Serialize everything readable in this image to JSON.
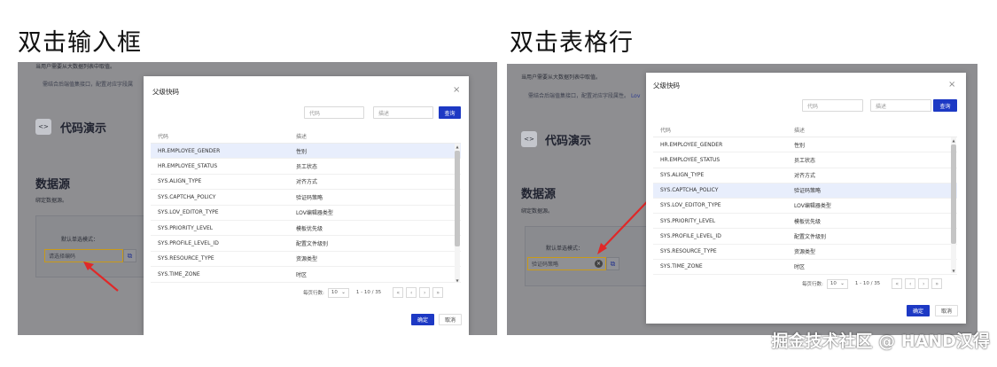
{
  "left_heading": "双击输入框",
  "right_heading": "双击表格行",
  "watermark": "掘金技术社区 @ HAND汉得",
  "bg": {
    "line1": "当用户需要从大数据列表中取值。",
    "line2_left": "需结合后端值集接口，配置对应字段属",
    "line2_right": "需结合后端值集接口，配置对应字段属性。",
    "line2_right_link": "Lov",
    "code_icon": "<>",
    "code_title": "代码演示",
    "datasource": "数据源",
    "bind_datasource": "绑定数据源。",
    "default_mode": "默认单选模式：",
    "left_placeholder": "请选择编码",
    "right_value": "验证码策略"
  },
  "modal": {
    "title": "父级快码",
    "close": "×",
    "code_placeholder": "代码",
    "desc_placeholder": "描述",
    "query_label": "查询",
    "col_code": "代码",
    "col_desc": "描述",
    "rows": [
      {
        "code": "HR.EMPLOYEE_GENDER",
        "desc": "性别"
      },
      {
        "code": "HR.EMPLOYEE_STATUS",
        "desc": "员工状态"
      },
      {
        "code": "SYS.ALIGN_TYPE",
        "desc": "对齐方式"
      },
      {
        "code": "SYS.CAPTCHA_POLICY",
        "desc": "验证码策略"
      },
      {
        "code": "SYS.LOV_EDITOR_TYPE",
        "desc": "LOV编辑器类型"
      },
      {
        "code": "SYS.PRIORITY_LEVEL",
        "desc": "模板优先级"
      },
      {
        "code": "SYS.PROFILE_LEVEL_ID",
        "desc": "配置文件级别"
      },
      {
        "code": "SYS.RESOURCE_TYPE",
        "desc": "资源类型"
      },
      {
        "code": "SYS.TIME_ZONE",
        "desc": "时区"
      }
    ],
    "page_size_label": "每页行数:",
    "page_size": "10",
    "range": "1 - 10 / 35",
    "ok_label": "确定",
    "cancel_label": "取消"
  },
  "colors": {
    "primary": "#1d39c4",
    "highlight": "#e8eefc",
    "arrow": "#e02828",
    "input_border": "#c99a18"
  }
}
